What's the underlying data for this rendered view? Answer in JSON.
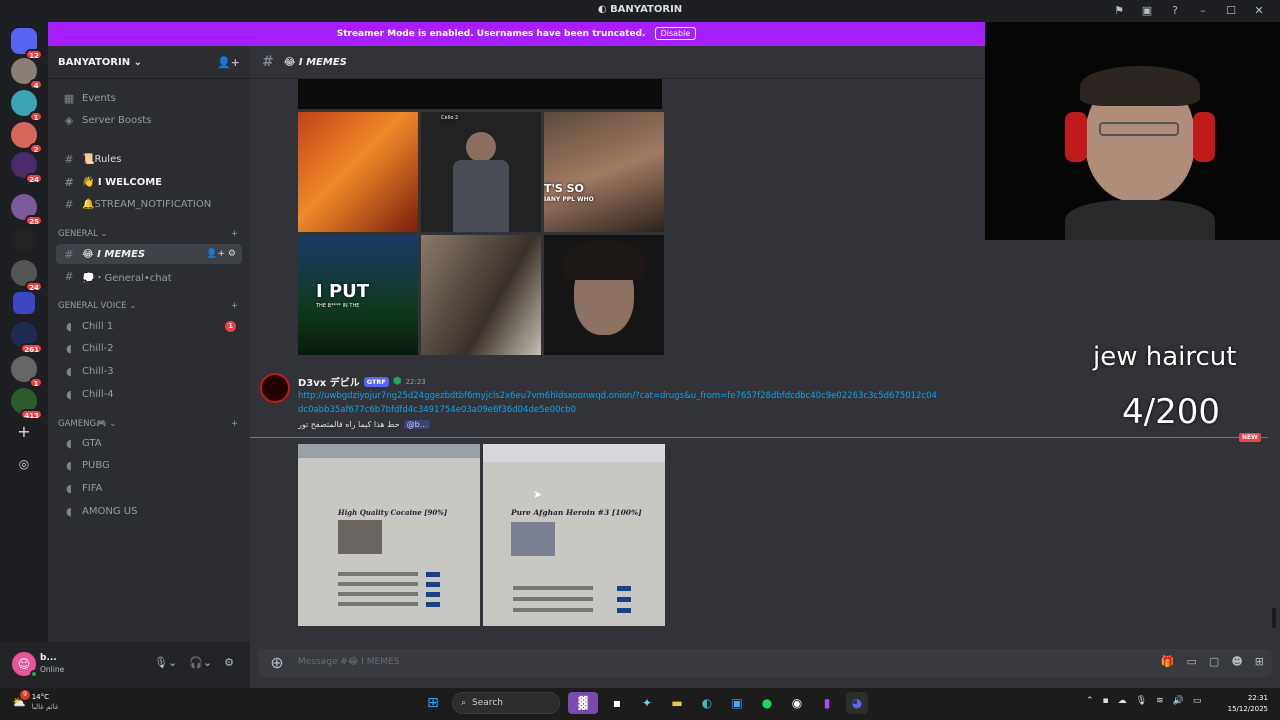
{
  "window": {
    "title": "BANYATORIN"
  },
  "banner": {
    "text": "Streamer Mode is enabled. Usernames have been truncated.",
    "button": "Disable"
  },
  "guild_badges": [
    "12",
    "4",
    "1",
    "2",
    "24",
    "25",
    "24",
    "261",
    "1",
    "413"
  ],
  "sidebar": {
    "server_name": "BANYATORIN",
    "top_items": [
      {
        "label": "Events",
        "icon": "calendar-icon"
      },
      {
        "label": "Server Boosts",
        "icon": "boost-icon"
      }
    ],
    "channels": [
      {
        "label": "📜Rules",
        "icon": "hash-icon"
      },
      {
        "label": "👋 I WELCOME",
        "icon": "hash-icon"
      },
      {
        "label": "🔔STREAM_NOTIFICATION",
        "icon": "hash-icon"
      }
    ],
    "category_general": "GENERAL",
    "general_channels": [
      {
        "label": "😂 I MEMES",
        "icon": "hash-icon"
      },
      {
        "label": "💭・General•chat",
        "icon": "hash-icon"
      }
    ],
    "category_voice": "GENERAL VOICE",
    "voice_channels": [
      {
        "label": "Chill 1",
        "badge": "1"
      },
      {
        "label": "Chill-2"
      },
      {
        "label": "Chill-3"
      },
      {
        "label": "Chill-4"
      }
    ],
    "category_gaming": "GAMENG🎮",
    "gaming_channels": [
      "GTA",
      "PUBG",
      "FIFA",
      "AMONG US"
    ]
  },
  "user_panel": {
    "name": "b...",
    "status": "Online"
  },
  "channel_header": {
    "name": "😂 I MEMES"
  },
  "overlay": {
    "caption": "jew haircut",
    "counter": "4/200"
  },
  "memes": {
    "text_it_so": "T'S SO",
    "text_many": "IANY PPL WHO",
    "text_i_put": "I PUT",
    "text_the": "THE B**** IN THE",
    "tile2_caption": "Cello 2"
  },
  "message": {
    "author": "D3vx デビル",
    "tag": "GTRF",
    "time": "22:23",
    "link": "http://uwbgdziyojur7ng25d24ggezbdtbf6myjcls2x6eu7vm6hldsxoonwqd.onion/?cat=drugs&u_from=fe7657f28dbfdcdbc40c9e02263c3c5d675012c04dc0abb35af677c6b7bfdfd4c3491754e03a09e6f36d04de5e00cb0",
    "text": "حط هذا كيما راه فالمتصفح تور",
    "mention": "@b...",
    "new_label": "NEW"
  },
  "screenshots": [
    {
      "caption": "High Quality Cocaine [90%]"
    },
    {
      "caption": "Pure Afghan Heroin #3 [100%]"
    }
  ],
  "composer": {
    "placeholder": "Message #😂 I MEMES"
  },
  "taskbar": {
    "weather_temp": "14°C",
    "weather_desc": "غائم غالبا",
    "weather_badge": "9",
    "search": "Search",
    "time": "22:31",
    "date": "15/12/2025"
  },
  "colors": {
    "accent": "#5865f2",
    "banner": "#a51fff",
    "mention_red": "#f23f43",
    "link": "#00a8fc"
  }
}
